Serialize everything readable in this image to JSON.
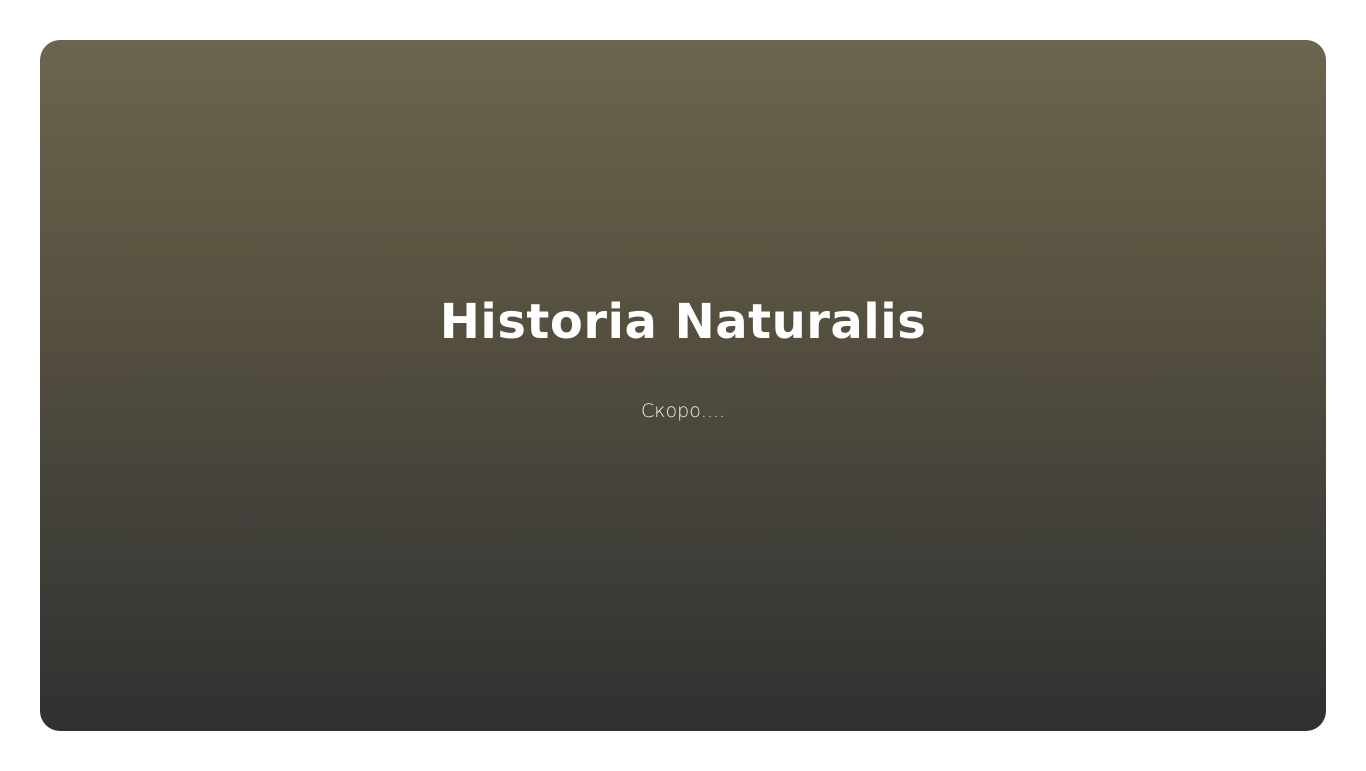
{
  "hero": {
    "title": "Historia Naturalis",
    "subtitle": "Скоро....",
    "gradient_top": "#6c654e",
    "gradient_bottom": "#303030",
    "text_color": "#ffffff"
  },
  "page": {
    "background": "#ffffff"
  }
}
